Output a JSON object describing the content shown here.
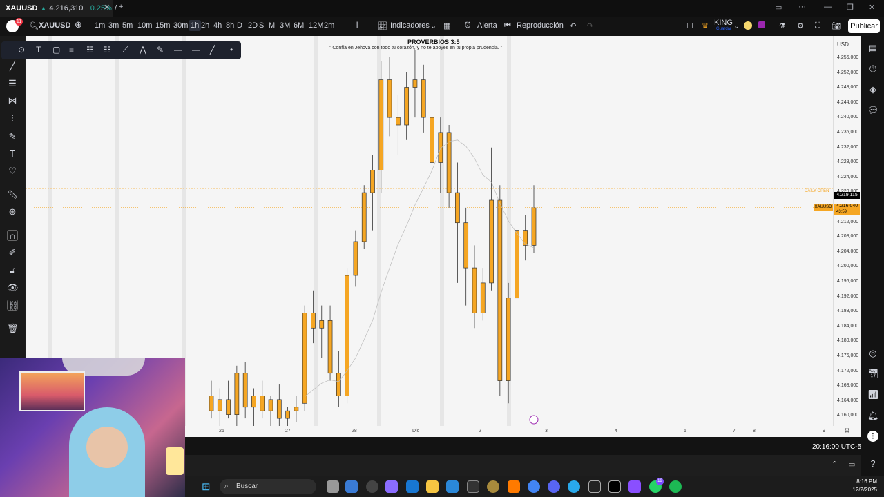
{
  "tab": {
    "symbol": "XAUUSD",
    "price": "4.216,310",
    "change": "+0.25%",
    "sep": "/",
    "badge": "11"
  },
  "toolbar": {
    "symbol": "XAUUSD",
    "intervals": [
      "1m",
      "3m",
      "5m",
      "10m",
      "15m",
      "30m",
      "1h",
      "2h",
      "4h",
      "8h",
      "D",
      "2D",
      "S",
      "M",
      "3M",
      "6M",
      "12M",
      "2m"
    ],
    "active_interval": "1h",
    "indicators": "Indicadores",
    "alert": "Alerta",
    "replay": "Reproducción",
    "user": "KING",
    "user_sub": "Guardar",
    "publish": "Publicar"
  },
  "chart": {
    "title": "PROVERBIOS 3:5",
    "subtitle": "\" Confía en Jehova con todo tu corazón, y no te apoyes en tu propia prudencia. \"",
    "daily_open_label": "DAILY OPEN",
    "currency": "USD",
    "last_price": "4.219,115",
    "symbol_tag": "XAUUSD",
    "current_price": "4.216,040",
    "countdown": "43:59",
    "price_ticks": [
      "4.256,000",
      "4.252,000",
      "4.248,000",
      "4.244,000",
      "4.240,000",
      "4.236,000",
      "4.232,000",
      "4.228,000",
      "4.224,000",
      "4.220,000",
      "4.212,000",
      "4.208,000",
      "4.204,000",
      "4.200,000",
      "4.196,000",
      "4.192,000",
      "4.188,000",
      "4.184,000",
      "4.180,000",
      "4.176,000",
      "4.172,000",
      "4.168,000",
      "4.164,000",
      "4.160,000"
    ],
    "time_ticks": [
      "26",
      "27",
      "28",
      "Dic",
      "2",
      "3",
      "4",
      "5",
      "7",
      "8",
      "9"
    ],
    "footer_time": "20:16:00 UTC-5"
  },
  "chart_data": {
    "type": "candlestick",
    "symbol": "XAUUSD",
    "interval": "1h",
    "ylim": [
      4158,
      4258
    ],
    "daily_open": 4221,
    "last": 4216.04,
    "candles": [
      {
        "o": 4166,
        "h": 4170,
        "l": 4160,
        "c": 4162
      },
      {
        "o": 4162,
        "h": 4168,
        "l": 4158,
        "c": 4165
      },
      {
        "o": 4165,
        "h": 4170,
        "l": 4160,
        "c": 4161
      },
      {
        "o": 4161,
        "h": 4174,
        "l": 4158,
        "c": 4172
      },
      {
        "o": 4172,
        "h": 4175,
        "l": 4160,
        "c": 4163
      },
      {
        "o": 4163,
        "h": 4168,
        "l": 4158,
        "c": 4166
      },
      {
        "o": 4166,
        "h": 4170,
        "l": 4160,
        "c": 4162
      },
      {
        "o": 4162,
        "h": 4166,
        "l": 4158,
        "c": 4165
      },
      {
        "o": 4165,
        "h": 4169,
        "l": 4158,
        "c": 4160
      },
      {
        "o": 4160,
        "h": 4163,
        "l": 4158,
        "c": 4162
      },
      {
        "o": 4162,
        "h": 4166,
        "l": 4159,
        "c": 4163
      },
      {
        "o": 4164,
        "h": 4190,
        "l": 4162,
        "c": 4188
      },
      {
        "o": 4188,
        "h": 4194,
        "l": 4180,
        "c": 4184
      },
      {
        "o": 4184,
        "h": 4190,
        "l": 4176,
        "c": 4186
      },
      {
        "o": 4186,
        "h": 4190,
        "l": 4170,
        "c": 4172
      },
      {
        "o": 4172,
        "h": 4178,
        "l": 4163,
        "c": 4166
      },
      {
        "o": 4166,
        "h": 4200,
        "l": 4164,
        "c": 4198
      },
      {
        "o": 4198,
        "h": 4210,
        "l": 4195,
        "c": 4207
      },
      {
        "o": 4207,
        "h": 4222,
        "l": 4205,
        "c": 4220
      },
      {
        "o": 4220,
        "h": 4230,
        "l": 4210,
        "c": 4226
      },
      {
        "o": 4226,
        "h": 4255,
        "l": 4220,
        "c": 4250
      },
      {
        "o": 4250,
        "h": 4256,
        "l": 4235,
        "c": 4240
      },
      {
        "o": 4240,
        "h": 4246,
        "l": 4230,
        "c": 4238
      },
      {
        "o": 4238,
        "h": 4252,
        "l": 4234,
        "c": 4248
      },
      {
        "o": 4248,
        "h": 4258,
        "l": 4240,
        "c": 4250
      },
      {
        "o": 4250,
        "h": 4254,
        "l": 4236,
        "c": 4240
      },
      {
        "o": 4240,
        "h": 4244,
        "l": 4222,
        "c": 4228
      },
      {
        "o": 4228,
        "h": 4240,
        "l": 4220,
        "c": 4236
      },
      {
        "o": 4236,
        "h": 4238,
        "l": 4216,
        "c": 4220
      },
      {
        "o": 4220,
        "h": 4228,
        "l": 4196,
        "c": 4212
      },
      {
        "o": 4212,
        "h": 4216,
        "l": 4190,
        "c": 4200
      },
      {
        "o": 4200,
        "h": 4206,
        "l": 4184,
        "c": 4188
      },
      {
        "o": 4188,
        "h": 4200,
        "l": 4186,
        "c": 4196
      },
      {
        "o": 4196,
        "h": 4232,
        "l": 4194,
        "c": 4218
      },
      {
        "o": 4218,
        "h": 4222,
        "l": 4166,
        "c": 4170
      },
      {
        "o": 4170,
        "h": 4196,
        "l": 4164,
        "c": 4192
      },
      {
        "o": 4192,
        "h": 4212,
        "l": 4190,
        "c": 4210
      },
      {
        "o": 4210,
        "h": 4214,
        "l": 4202,
        "c": 4206
      },
      {
        "o": 4206,
        "h": 4222,
        "l": 4204,
        "c": 4216
      }
    ]
  },
  "taskbar": {
    "search": "Buscar",
    "time": "8:16 PM",
    "date": "12/2/2025",
    "badge": "19"
  }
}
